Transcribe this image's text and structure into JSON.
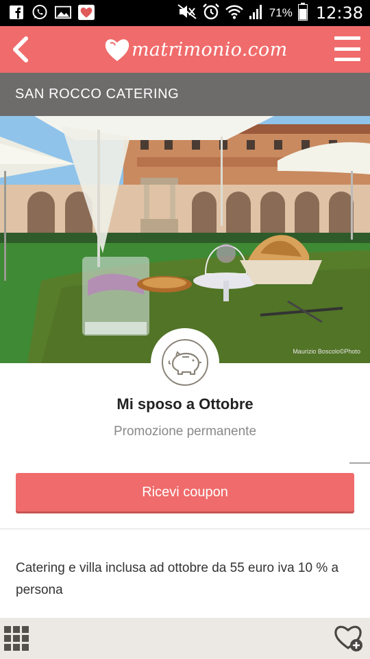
{
  "status_bar": {
    "battery_percent": "71%",
    "time": "12:38",
    "icons": [
      "facebook-icon",
      "whatsapp-icon",
      "gallery-icon",
      "heart-app-icon",
      "mute-icon",
      "alarm-icon",
      "wifi-icon",
      "signal-icon",
      "battery-icon"
    ]
  },
  "app_bar": {
    "logo_text": "matrimonio.com",
    "accent_color": "#f06b6b"
  },
  "vendor": {
    "name": "SAN ROCCO CATERING"
  },
  "hero": {
    "credit": "Maurizio Boscolo©Photo"
  },
  "promo": {
    "badge_icon": "piggy-bank-icon",
    "title": "Mi sposo a Ottobre",
    "subtitle": "Promozione permanente",
    "button_label": "Ricevi coupon",
    "description": "Catering e villa inclusa ad ottobre da 55 euro iva 10 % a persona"
  },
  "bottom_bar": {
    "icons": [
      "grid-menu-icon",
      "heart-add-icon"
    ]
  }
}
